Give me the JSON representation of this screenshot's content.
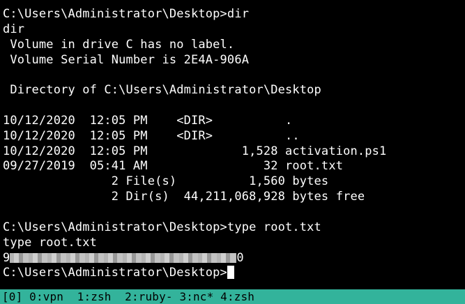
{
  "terminal": {
    "lines": [
      "C:\\Users\\Administrator\\Desktop>dir",
      "dir",
      " Volume in drive C has no label.",
      " Volume Serial Number is 2E4A-906A",
      "",
      " Directory of C:\\Users\\Administrator\\Desktop",
      "",
      "10/12/2020  12:05 PM    <DIR>          .",
      "10/12/2020  12:05 PM    <DIR>          ..",
      "10/12/2020  12:05 PM             1,528 activation.ps1",
      "09/27/2019  05:41 AM                32 root.txt",
      "               2 File(s)          1,560 bytes",
      "               2 Dir(s)  44,211,068,928 bytes free",
      "",
      "C:\\Users\\Administrator\\Desktop>type root.txt",
      "type root.txt"
    ],
    "flag_prefix": "9",
    "flag_suffix": "0",
    "prompt": "C:\\Users\\Administrator\\Desktop>"
  },
  "statusbar": {
    "session": "[0]",
    "windows": [
      "0:vpn",
      "1:zsh",
      "2:ruby-",
      "3:nc*",
      "4:zsh"
    ]
  },
  "colors": {
    "background": "#000000",
    "foreground": "#ffffff",
    "statusbar_bg": "#33b39b",
    "statusbar_fg": "#000000"
  }
}
